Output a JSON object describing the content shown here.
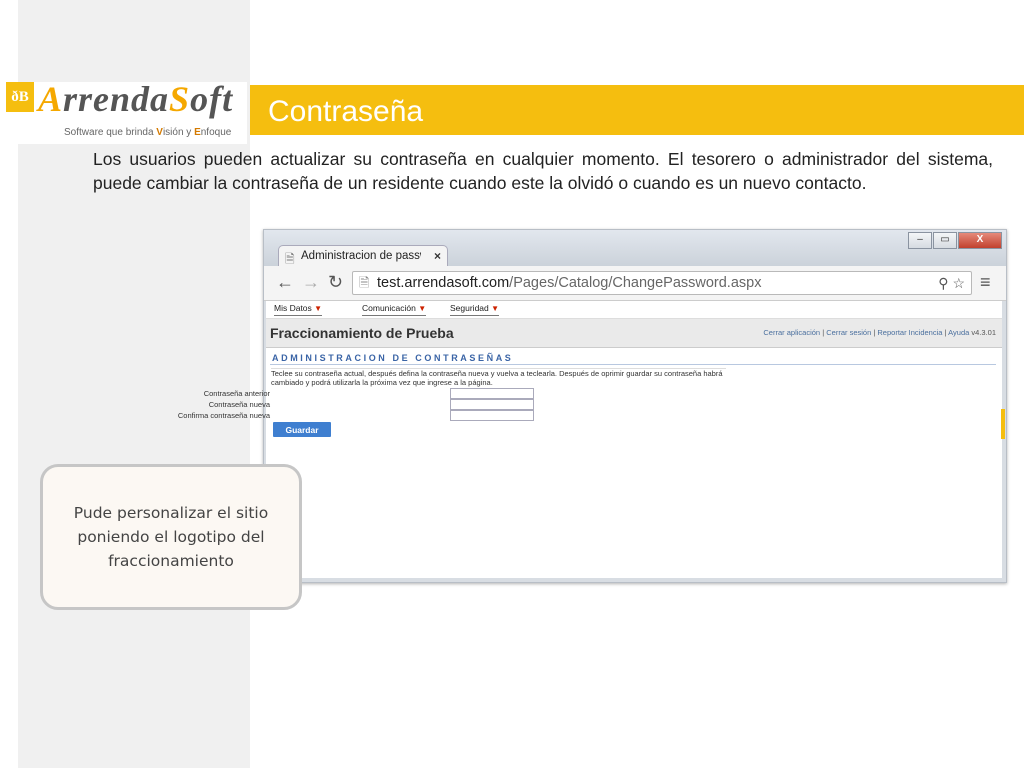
{
  "slide": {
    "title": "Contraseña",
    "intro_text": "Los usuarios pueden actualizar su contraseña en cualquier momento. El tesorero o administrador del sistema, puede cambiar la contraseña de un residente cuando este la olvidó o cuando es un nuevo contacto.",
    "callout_text": "Pude personalizar el sitio poniendo el logotipo del fraccionamiento"
  },
  "logo": {
    "badge": "ðB",
    "name_part1": "A",
    "name_part2": "rrenda",
    "name_part3": "S",
    "name_part4": "oft",
    "tagline_pre": "Software  que brinda ",
    "tagline_v": "V",
    "tagline_mid": "isión y ",
    "tagline_e": "E",
    "tagline_post": "nfoque"
  },
  "browser": {
    "tab_title": "Administracion de passw",
    "tab_close": "×",
    "url_host": "test.arrendasoft.com",
    "url_path": "/Pages/Catalog/ChangePassword.aspx",
    "window_buttons": [
      "‒",
      "▭",
      "X"
    ]
  },
  "app": {
    "menu": [
      "Mis Datos",
      "Comunicación",
      "Seguridad"
    ],
    "site_title": "Fraccionamiento de Prueba",
    "header_links": [
      "Cerrar aplicación",
      "Cerrar sesión",
      "Reportar Incidencia",
      "Ayuda"
    ],
    "version": "v4.3.01",
    "section_title": "ADMINISTRACION DE CONTRASEÑAS",
    "instructions": "Teclee su contraseña actual, después defina la contraseña nueva y vuelva a teclearla. Después de oprimir guardar su contraseña habrá cambiado y podrá utilizarla la próxima vez que ingrese a la página.",
    "fields": [
      {
        "label": "Contraseña anterior",
        "value": ""
      },
      {
        "label": "Contraseña nueva",
        "value": ""
      },
      {
        "label": "Confirma contraseña nueva",
        "value": ""
      }
    ],
    "save_label": "Guardar"
  },
  "colors": {
    "accent": "#f5be0f",
    "button_blue": "#3f7fd0",
    "link_blue": "#4a6f9e"
  }
}
